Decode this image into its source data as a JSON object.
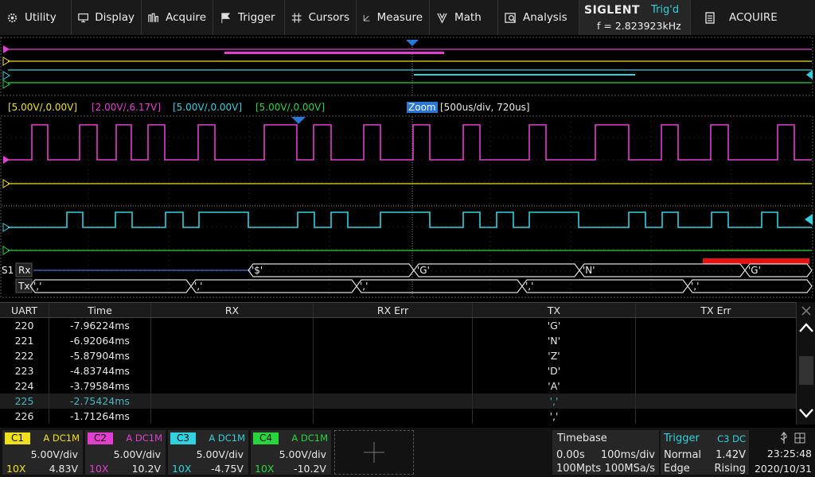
{
  "menu": {
    "utility": "Utility",
    "display": "Display",
    "acquire": "Acquire",
    "trigger": "Trigger",
    "cursors": "Cursors",
    "measure": "Measure",
    "math": "Math",
    "analysis": "Analysis"
  },
  "brand": {
    "logo": "SIGLENT",
    "trig_status": "Trig'd",
    "frequency": "f = 2.823923kHz"
  },
  "acquire_mode": "ACQUIRE",
  "channel_status": {
    "c1": "[5.00V/,0.00V]",
    "c2": "[2.00V/,6.17V]",
    "c3": "[5.00V/,0.00V]",
    "c4": "[5.00V/,0.00V]",
    "zoom": "Zoom",
    "zoom_info": "[500us/div, 720us]"
  },
  "bus": {
    "name": "S1",
    "rx_label": "Rx",
    "tx_label": "Tx",
    "rx_frames": [
      "'$'",
      "'G'",
      "'N'",
      "'G'"
    ],
    "tx_frames": [
      "','",
      "','",
      "','",
      "','",
      "','"
    ]
  },
  "table": {
    "headers": [
      "UART",
      "Time",
      "RX",
      "RX Err",
      "TX",
      "TX Err"
    ],
    "rows": [
      {
        "uart": "220",
        "time": "-7.96224ms",
        "rx": "",
        "rxerr": "",
        "tx": "'G'",
        "txerr": ""
      },
      {
        "uart": "221",
        "time": "-6.92064ms",
        "rx": "",
        "rxerr": "",
        "tx": "'N'",
        "txerr": ""
      },
      {
        "uart": "222",
        "time": "-5.87904ms",
        "rx": "",
        "rxerr": "",
        "tx": "'Z'",
        "txerr": ""
      },
      {
        "uart": "223",
        "time": "-4.83744ms",
        "rx": "",
        "rxerr": "",
        "tx": "'D'",
        "txerr": ""
      },
      {
        "uart": "224",
        "time": "-3.79584ms",
        "rx": "",
        "rxerr": "",
        "tx": "'A'",
        "txerr": ""
      },
      {
        "uart": "225",
        "time": "-2.75424ms",
        "rx": "",
        "rxerr": "",
        "tx": "','",
        "txerr": ""
      },
      {
        "uart": "226",
        "time": "-1.71264ms",
        "rx": "",
        "rxerr": "",
        "tx": "','",
        "txerr": ""
      }
    ],
    "selected_row": "225"
  },
  "channels": [
    {
      "tag": "C1",
      "coupling": "A DC1M",
      "scale": "5.00V/div",
      "probe": "10X",
      "offset": "4.83V",
      "color": "#f0e01c"
    },
    {
      "tag": "C2",
      "coupling": "A DC1M",
      "scale": "5.00V/div",
      "probe": "10X",
      "offset": "10.2V",
      "color": "#e23fd0"
    },
    {
      "tag": "C3",
      "coupling": "A DC1M",
      "scale": "5.00V/div",
      "probe": "10X",
      "offset": "-4.75V",
      "color": "#2fd2e0"
    },
    {
      "tag": "C4",
      "coupling": "A DC1M",
      "scale": "5.00V/div",
      "probe": "10X",
      "offset": "-10.2V",
      "color": "#28d63c"
    }
  ],
  "timebase": {
    "label": "Timebase",
    "delay": "0.00s",
    "scale": "100ms/div",
    "memory": "100Mpts",
    "sample_rate": "100MSa/s"
  },
  "trigger": {
    "label": "Trigger",
    "source": "C3 DC",
    "mode": "Normal",
    "level": "1.42V",
    "type": "Edge",
    "slope": "Rising"
  },
  "clock": {
    "time": "23:25:48",
    "date": "2020/10/31"
  }
}
